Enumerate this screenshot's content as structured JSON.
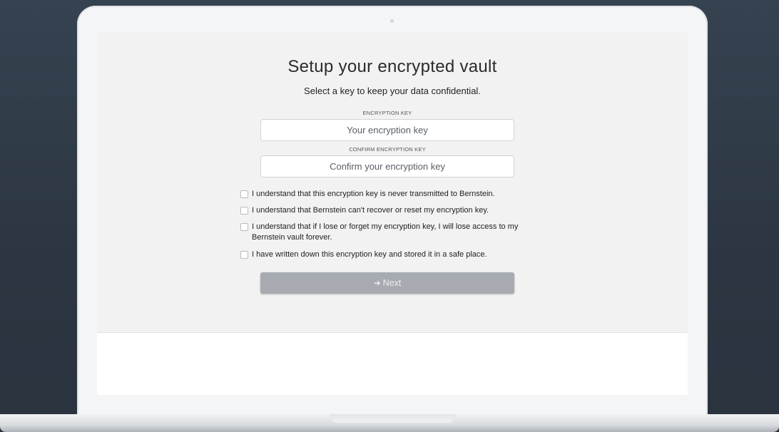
{
  "vault": {
    "title": "Setup your encrypted vault",
    "subtitle": "Select a key to keep your data confidential.",
    "key_label": "ENCRYPTION KEY",
    "key_placeholder": "Your encryption key",
    "confirm_label": "CONFIRM ENCRYPTION KEY",
    "confirm_placeholder": "Confirm your encryption key",
    "checks": [
      "I understand that this encryption key is never transmitted to Bernstein.",
      "I understand that Bernstein can't recover or reset my encryption key.",
      "I understand that if I lose or forget my encryption key, I will lose access to my Bernstein vault forever.",
      "I have written down this encryption key and stored it in a safe place."
    ],
    "next_label": "Next",
    "next_icon": "sign-in-icon"
  }
}
